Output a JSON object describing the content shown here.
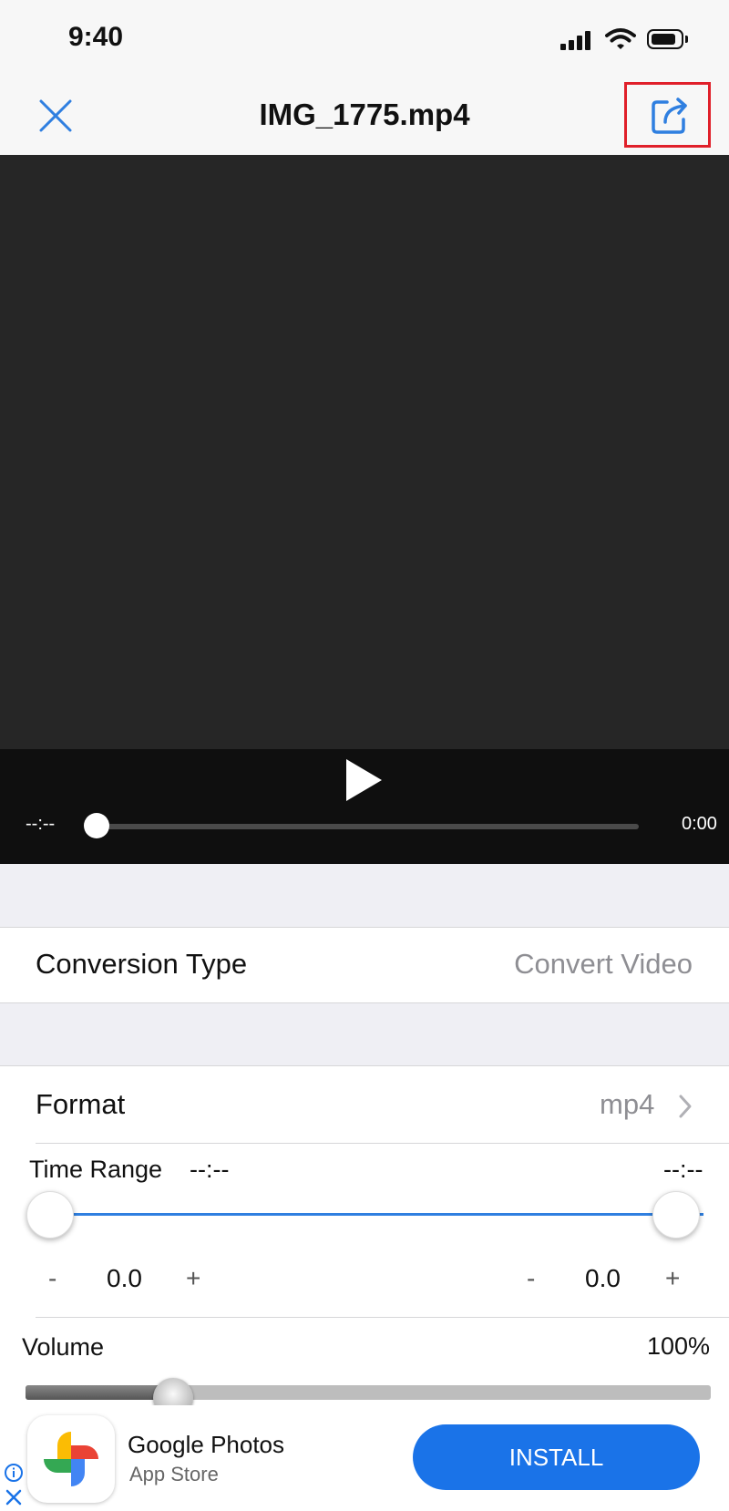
{
  "status_bar": {
    "time": "9:40"
  },
  "nav": {
    "title": "IMG_1775.mp4",
    "close_icon": "close-icon",
    "share_icon": "share-icon"
  },
  "player": {
    "elapsed": "--:--",
    "duration": "0:00",
    "progress": 0
  },
  "conversion": {
    "label": "Conversion Type",
    "value": "Convert Video"
  },
  "format": {
    "label": "Format",
    "value": "mp4"
  },
  "time_range": {
    "label": "Time Range",
    "start": "--:--",
    "end": "--:--",
    "start_offset": "0.0",
    "end_offset": "0.0",
    "minus": "-",
    "plus": "+"
  },
  "volume": {
    "label": "Volume",
    "value": "100%",
    "level": 0.18
  },
  "ad": {
    "name": "Google Photos",
    "subtitle": "App Store",
    "install_label": "INSTALL"
  },
  "colors": {
    "accent": "#2f7fe0",
    "highlight": "#e0202a",
    "install": "#1a73e8"
  }
}
